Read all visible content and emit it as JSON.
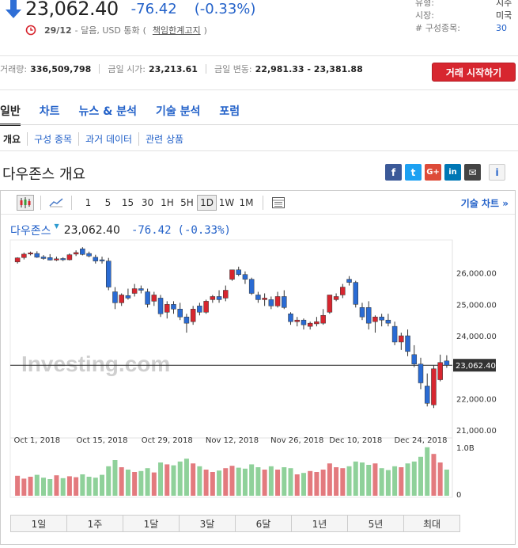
{
  "quote": {
    "price": "23,062.40",
    "change": "-76.42",
    "change_pct": "(-0.33%)",
    "time": "29/12",
    "time_note": "- 달음, USD 통화",
    "disclaimer": "책임한계고지",
    "paren_open": "(",
    "paren_close": ")",
    "colors": {
      "down": "#2462c9",
      "up": "#d7262f",
      "trade": "#d7262f"
    }
  },
  "info": {
    "rows": [
      {
        "k": "유형:",
        "v": "지수"
      },
      {
        "k": "시장:",
        "v": "미국"
      },
      {
        "k": "# 구성종목:",
        "v": "30"
      }
    ]
  },
  "stats": {
    "volume_label": "거래량:",
    "volume": "336,509,798",
    "open_label": "금일 시가:",
    "open": "23,213.61",
    "range_label": "금일 변동:",
    "range": "22,981.33 - 23,381.88"
  },
  "trade_button": "거래 시작하기",
  "main_tabs": [
    "일반",
    "차트",
    "뉴스 & 분석",
    "기술 분석",
    "포럼"
  ],
  "sub_tabs": [
    "개요",
    "구성 종목",
    "과거 데이터",
    "관련 상품"
  ],
  "section_title": "다우존스 개요",
  "social": {
    "fb": "f",
    "tw": "t",
    "gp": "G+",
    "li": "in",
    "em": "✉",
    "info": "i"
  },
  "toolbar": {
    "intervals": [
      "1",
      "5",
      "15",
      "30",
      "1H",
      "5H",
      "1D",
      "1W",
      "1M"
    ],
    "active_interval": "1D",
    "tech_chart": "기술 차트 »"
  },
  "chart_head": {
    "name": "다우존스",
    "price": "23,062.40",
    "change": "-76.42",
    "change_pct": "(-0.33%)"
  },
  "range_buttons": [
    "1일",
    "1주",
    "1달",
    "3달",
    "6달",
    "1년",
    "5년",
    "최대"
  ],
  "chart_data": {
    "type": "candlestick",
    "watermark": "Investing.com",
    "y_ticks": [
      21000,
      22000,
      23000,
      24000,
      25000,
      26000
    ],
    "y_tick_labels": [
      "21,000.00",
      "22,000.00",
      "",
      "24,000.00",
      "25,000.00",
      "26,000.00"
    ],
    "ylim": [
      21000,
      26900
    ],
    "current_price": 23062.4,
    "current_price_label": "23,062.40",
    "x_labels": [
      "Oct 1, 2018",
      "Oct 15, 2018",
      "Oct 29, 2018",
      "Nov 12, 2018",
      "Nov 26, 2018",
      "Dec 10, 2018",
      "Dec 24, 2018"
    ],
    "x_label_index": [
      3,
      13,
      23,
      33,
      43,
      52,
      62
    ],
    "volume_axis": {
      "max_label": "1.0B",
      "zero_label": "0",
      "max_value": 1.0
    },
    "candles": [
      {
        "o": 26350,
        "h": 26500,
        "l": 26300,
        "c": 26480,
        "v": 0.42
      },
      {
        "o": 26490,
        "h": 26650,
        "l": 26430,
        "c": 26600,
        "v": 0.36
      },
      {
        "o": 26620,
        "h": 26680,
        "l": 26560,
        "c": 26640,
        "v": 0.4
      },
      {
        "o": 26620,
        "h": 26690,
        "l": 26480,
        "c": 26500,
        "v": 0.44
      },
      {
        "o": 26510,
        "h": 26570,
        "l": 26420,
        "c": 26460,
        "v": 0.38
      },
      {
        "o": 26490,
        "h": 26600,
        "l": 26400,
        "c": 26410,
        "v": 0.35
      },
      {
        "o": 26410,
        "h": 26520,
        "l": 26380,
        "c": 26450,
        "v": 0.43
      },
      {
        "o": 26460,
        "h": 26500,
        "l": 26380,
        "c": 26420,
        "v": 0.37
      },
      {
        "o": 26420,
        "h": 26620,
        "l": 26400,
        "c": 26580,
        "v": 0.41
      },
      {
        "o": 26600,
        "h": 26720,
        "l": 26540,
        "c": 26650,
        "v": 0.39
      },
      {
        "o": 26770,
        "h": 26820,
        "l": 26560,
        "c": 26590,
        "v": 0.45
      },
      {
        "o": 26620,
        "h": 26680,
        "l": 26500,
        "c": 26540,
        "v": 0.4
      },
      {
        "o": 26500,
        "h": 26580,
        "l": 26300,
        "c": 26380,
        "v": 0.38
      },
      {
        "o": 26420,
        "h": 26520,
        "l": 26300,
        "c": 26400,
        "v": 0.44
      },
      {
        "o": 26380,
        "h": 26480,
        "l": 25450,
        "c": 25550,
        "v": 0.62
      },
      {
        "o": 25400,
        "h": 25550,
        "l": 24850,
        "c": 25050,
        "v": 0.75
      },
      {
        "o": 25050,
        "h": 25350,
        "l": 24950,
        "c": 25300,
        "v": 0.6
      },
      {
        "o": 25280,
        "h": 25500,
        "l": 25150,
        "c": 25200,
        "v": 0.55
      },
      {
        "o": 25350,
        "h": 25650,
        "l": 25250,
        "c": 25500,
        "v": 0.5
      },
      {
        "o": 25500,
        "h": 25600,
        "l": 25350,
        "c": 25450,
        "v": 0.52
      },
      {
        "o": 25400,
        "h": 25500,
        "l": 24900,
        "c": 25000,
        "v": 0.58
      },
      {
        "o": 25100,
        "h": 25400,
        "l": 24950,
        "c": 25300,
        "v": 0.49
      },
      {
        "o": 25200,
        "h": 25300,
        "l": 24600,
        "c": 24700,
        "v": 0.7
      },
      {
        "o": 24750,
        "h": 25100,
        "l": 24550,
        "c": 25000,
        "v": 0.66
      },
      {
        "o": 25000,
        "h": 25100,
        "l": 24700,
        "c": 24850,
        "v": 0.64
      },
      {
        "o": 24850,
        "h": 25050,
        "l": 24500,
        "c": 24600,
        "v": 0.72
      },
      {
        "o": 24600,
        "h": 24700,
        "l": 24100,
        "c": 24400,
        "v": 0.78
      },
      {
        "o": 24450,
        "h": 24950,
        "l": 24350,
        "c": 24850,
        "v": 0.68
      },
      {
        "o": 24950,
        "h": 25050,
        "l": 24650,
        "c": 24750,
        "v": 0.62
      },
      {
        "o": 24750,
        "h": 25150,
        "l": 24700,
        "c": 25100,
        "v": 0.55
      },
      {
        "o": 25150,
        "h": 25300,
        "l": 25050,
        "c": 25250,
        "v": 0.5
      },
      {
        "o": 25250,
        "h": 25450,
        "l": 25050,
        "c": 25150,
        "v": 0.53
      },
      {
        "o": 25200,
        "h": 25600,
        "l": 25100,
        "c": 25450,
        "v": 0.58
      },
      {
        "o": 25800,
        "h": 26100,
        "l": 25750,
        "c": 26100,
        "v": 0.63
      },
      {
        "o": 26100,
        "h": 26200,
        "l": 25900,
        "c": 25950,
        "v": 0.59
      },
      {
        "o": 25950,
        "h": 26050,
        "l": 25650,
        "c": 25800,
        "v": 0.57
      },
      {
        "o": 25800,
        "h": 25850,
        "l": 25300,
        "c": 25350,
        "v": 0.66
      },
      {
        "o": 25300,
        "h": 25400,
        "l": 25050,
        "c": 25150,
        "v": 0.6
      },
      {
        "o": 25150,
        "h": 25350,
        "l": 24950,
        "c": 25200,
        "v": 0.55
      },
      {
        "o": 25150,
        "h": 25250,
        "l": 24850,
        "c": 24950,
        "v": 0.62
      },
      {
        "o": 24950,
        "h": 25400,
        "l": 24900,
        "c": 25250,
        "v": 0.55
      },
      {
        "o": 25250,
        "h": 25450,
        "l": 24850,
        "c": 24900,
        "v": 0.6
      },
      {
        "o": 24700,
        "h": 24750,
        "l": 24350,
        "c": 24450,
        "v": 0.58
      },
      {
        "o": 24450,
        "h": 24600,
        "l": 24300,
        "c": 24500,
        "v": 0.45
      },
      {
        "o": 24500,
        "h": 24550,
        "l": 24200,
        "c": 24350,
        "v": 0.48
      },
      {
        "o": 24300,
        "h": 24450,
        "l": 24200,
        "c": 24400,
        "v": 0.52
      },
      {
        "o": 24380,
        "h": 24600,
        "l": 24300,
        "c": 24450,
        "v": 0.5
      },
      {
        "o": 24400,
        "h": 24850,
        "l": 24350,
        "c": 24650,
        "v": 0.55
      },
      {
        "o": 24750,
        "h": 25300,
        "l": 24700,
        "c": 25300,
        "v": 0.68
      },
      {
        "o": 25150,
        "h": 25350,
        "l": 25100,
        "c": 25250,
        "v": 0.6
      },
      {
        "o": 25300,
        "h": 25650,
        "l": 25200,
        "c": 25550,
        "v": 0.58
      },
      {
        "o": 25800,
        "h": 25900,
        "l": 25600,
        "c": 25700,
        "v": 0.62
      },
      {
        "o": 25700,
        "h": 25750,
        "l": 24900,
        "c": 25000,
        "v": 0.72
      },
      {
        "o": 24900,
        "h": 25050,
        "l": 24500,
        "c": 24600,
        "v": 0.7
      },
      {
        "o": 24900,
        "h": 25100,
        "l": 24200,
        "c": 24400,
        "v": 0.65
      },
      {
        "o": 24450,
        "h": 24650,
        "l": 24100,
        "c": 24600,
        "v": 0.68
      },
      {
        "o": 24600,
        "h": 24700,
        "l": 24300,
        "c": 24500,
        "v": 0.58
      },
      {
        "o": 24500,
        "h": 24700,
        "l": 24300,
        "c": 24400,
        "v": 0.54
      },
      {
        "o": 24300,
        "h": 24450,
        "l": 23700,
        "c": 23800,
        "v": 0.62
      },
      {
        "o": 23800,
        "h": 24100,
        "l": 23550,
        "c": 24000,
        "v": 0.6
      },
      {
        "o": 24000,
        "h": 24200,
        "l": 23350,
        "c": 23500,
        "v": 0.68
      },
      {
        "o": 23400,
        "h": 23700,
        "l": 23000,
        "c": 23100,
        "v": 0.72
      },
      {
        "o": 23100,
        "h": 23300,
        "l": 22300,
        "c": 22500,
        "v": 0.82
      },
      {
        "o": 22400,
        "h": 22800,
        "l": 21750,
        "c": 21850,
        "v": 1.02
      },
      {
        "o": 21800,
        "h": 23050,
        "l": 21700,
        "c": 22950,
        "v": 0.88
      },
      {
        "o": 22600,
        "h": 23400,
        "l": 22550,
        "c": 23150,
        "v": 0.7
      },
      {
        "o": 23200,
        "h": 23380,
        "l": 22980,
        "c": 23062,
        "v": 0.55
      }
    ]
  }
}
